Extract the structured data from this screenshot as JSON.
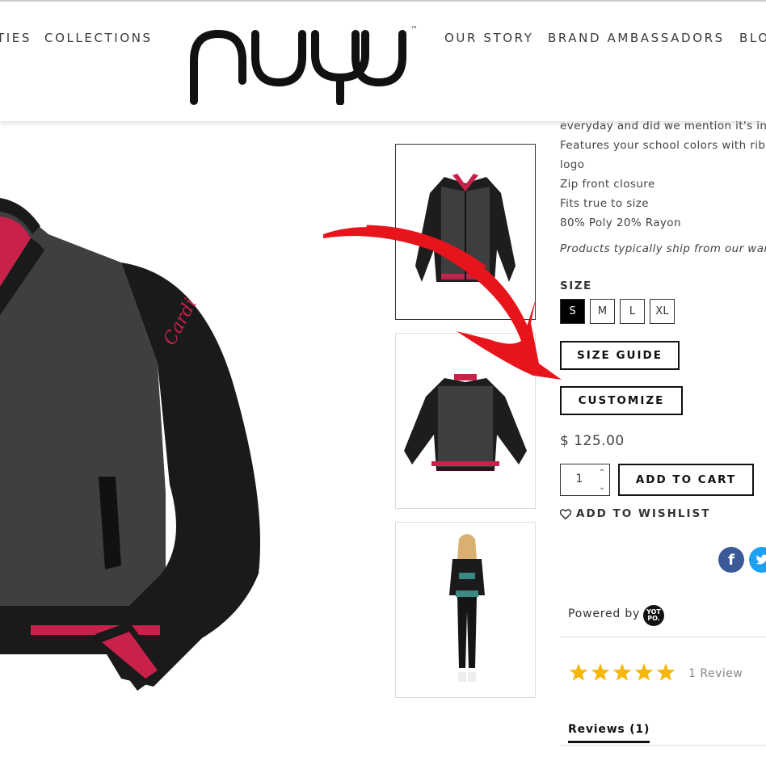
{
  "nav": {
    "left": [
      "TIES",
      "COLLECTIONS"
    ],
    "right": [
      "OUR STORY",
      "BRAND AMBASSADORS",
      "BLO"
    ]
  },
  "brand": {
    "logo_text": "nuyu",
    "trademark": "™"
  },
  "product": {
    "description_lines": [
      "everyday and did we mention it's inc",
      "Features your school colors with ribl",
      "logo",
      "Zip front closure",
      "Fits true to size",
      "80% Poly  20% Rayon"
    ],
    "shipping_note": "Products typically ship from our wareh",
    "embroidery": "Cardi",
    "size_label": "SIZE",
    "sizes": [
      "S",
      "M",
      "L",
      "XL"
    ],
    "selected_size": "S",
    "size_guide_label": "SIZE GUIDE",
    "customize_label": "CUSTOMIZE",
    "price": "$ 125.00",
    "quantity": "1",
    "add_to_cart_label": "ADD TO CART",
    "wishlist_label": "ADD TO WISHLIST"
  },
  "reviews": {
    "powered_by": "Powered by",
    "yotpo_logo": "YOT PO.",
    "rating": 5,
    "count_label": "1 Review",
    "tab_label": "Reviews (1)"
  },
  "colors": {
    "accent_red": "#e8141c",
    "stripe_red": "#c8214a",
    "jacket_gray": "#3f3f41",
    "jacket_black": "#1a1a1a",
    "star_gold": "#f5b70a",
    "facebook": "#3b5998",
    "twitter": "#1da1f2"
  }
}
